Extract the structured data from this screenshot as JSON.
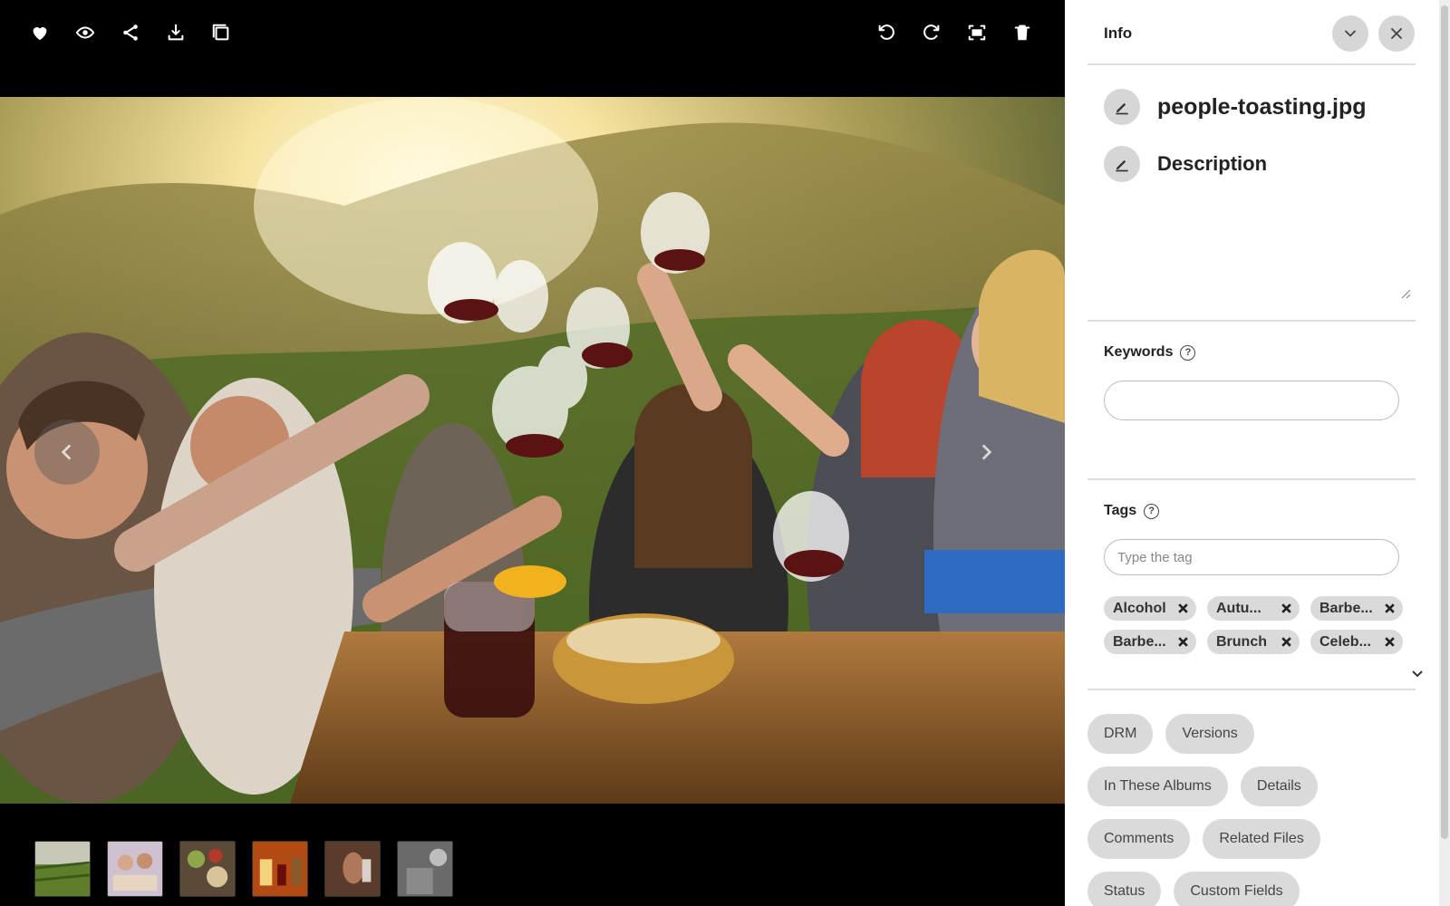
{
  "toolbar": {
    "left_icons": [
      "heart-icon",
      "eye-icon",
      "share-icon",
      "download-icon",
      "copy-icon"
    ],
    "right_icons": [
      "rotate-left-icon",
      "rotate-right-icon",
      "fit-screen-icon",
      "trash-icon"
    ]
  },
  "viewer": {
    "thumbnails": [
      "vineyard",
      "friends-picnic",
      "food-table",
      "wine-glasses",
      "toasting-close",
      "party"
    ]
  },
  "panel": {
    "title": "Info",
    "filename": "people-toasting.jpg",
    "description_label": "Description",
    "keywords": {
      "label": "Keywords",
      "value": ""
    },
    "tags": {
      "label": "Tags",
      "placeholder": "Type the tag",
      "items": [
        "Alcohol",
        "Autu...",
        "Barbe...",
        "Barbe...",
        "Brunch",
        "Celeb..."
      ]
    },
    "sections": [
      [
        "DRM",
        "Versions"
      ],
      [
        "In These Albums",
        "Details"
      ],
      [
        "Comments",
        "Related Files"
      ],
      [
        "Status",
        "Custom Fields"
      ]
    ]
  },
  "colors": {
    "viewer_bg": "#000000",
    "panel_bg": "#ffffff",
    "pill_bg": "#dadada",
    "divider": "#dddddd"
  }
}
